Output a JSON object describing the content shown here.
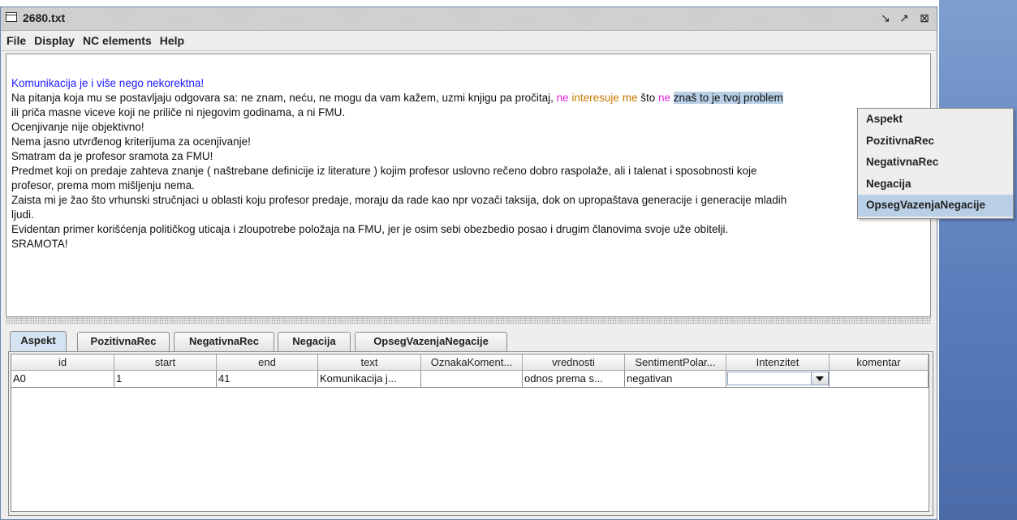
{
  "window": {
    "title": "2680.txt"
  },
  "menu": [
    "File",
    "Display",
    "NC elements",
    "Help"
  ],
  "editor": {
    "lines": [
      "Komunikacija je i više nego nekorektna!",
      "",
      "ili priča masne viceve koji ne priliče ni njegovim godinama, a ni FMU.",
      "Ocenjivanje nije objektivno!",
      "Nema jasno utvrđenog kriterijuma za ocenjivanje!",
      "Smatram da je profesor sramota za FMU!",
      "Predmet koji on predaje zahteva znanje ( naštrebane definicije iz literature ) kojim profesor uslovno rečeno dobro raspolaže, ali i talenat i sposobnosti koje",
      "profesor, prema mom mišljenju nema.",
      "Zaista mi je žao što vrhunski stručnjaci u oblasti koju profesor predaje, moraju da rade kao npr vozači taksija, dok on upropaštava generacije i generacije mladih",
      "ljudi.",
      "Evidentan primer korišćenja političkog uticaja i zloupotrebe položaja na FMU, jer je osim sebi obezbedio posao i drugim članovima svoje uže obitelji.",
      "SRAMOTA!"
    ],
    "line2": {
      "part1": "Na pitanja koja mu se postavljaju odgovara sa: ne znam, neću, ne mogu da vam kažem, uzmi knjigu pa pročitaj, ",
      "neg1": "ne",
      "sp1": " ",
      "interesuje": "interesuje me",
      "part2": " što ",
      "neg2": "ne",
      "sp2": " ",
      "selected": "znaš to je tvoj problem"
    }
  },
  "popup_menu": [
    "Aspekt",
    "PozitivnaRec",
    "NegativnaRec",
    "Negacija",
    "OpsegVazenjaNegacije"
  ],
  "tabs": [
    "Aspekt",
    "PozitivnaRec",
    "NegativnaRec",
    "Negacija",
    "OpsegVazenjaNegacije"
  ],
  "active_tab": "Aspekt",
  "table": {
    "columns": [
      "id",
      "start",
      "end",
      "text",
      "OznakaKoment...",
      "vrednosti",
      "SentimentPolar...",
      "Intenzitet",
      "komentar"
    ],
    "rows": [
      [
        "A0",
        "1",
        "41",
        "Komunikacija j...",
        "",
        "odnos prema s...",
        "negativan",
        "",
        ""
      ]
    ]
  },
  "colors": {
    "first_line": "#1a1aff",
    "negation": "#e020e0",
    "scope": "#c87800",
    "selection": "#b8cfe5",
    "active_tab": "#d5e4f3"
  },
  "icons": [
    "document-icon",
    "minimize-icon",
    "maximize-icon",
    "close-icon",
    "dropdown-arrow-icon"
  ]
}
